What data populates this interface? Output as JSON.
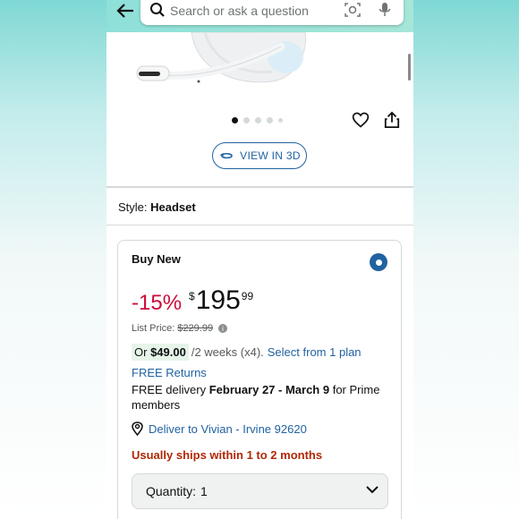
{
  "header": {
    "search_placeholder": "Search or ask a question",
    "icons": [
      "back-arrow-icon",
      "search-icon",
      "camera-lens-icon",
      "microphone-icon"
    ]
  },
  "gallery": {
    "dot_count": 5,
    "active_index": 0,
    "view_3d_label": "VIEW IN 3D"
  },
  "style": {
    "label": "Style:",
    "value": "Headset"
  },
  "buy_box": {
    "title": "Buy New",
    "discount": "-15%",
    "currency": "$",
    "price_whole": "195",
    "price_fraction": "99",
    "list_price_label": "List Price:",
    "list_price": "$229.99",
    "installment_or": "Or",
    "installment_amount": "$49.00",
    "installment_terms": "/2 weeks (x4).",
    "installment_link": "Select from 1 plan",
    "free_returns": "FREE Returns",
    "delivery_prefix": "FREE delivery",
    "delivery_dates": "February 27 - March 9",
    "delivery_suffix": "for Prime members",
    "deliver_to": "Deliver to Vivian - Irvine 92620",
    "ships_notice": "Usually ships within 1 to 2 months",
    "quantity_label": "Quantity:",
    "quantity_value": "1"
  },
  "colors": {
    "link": "#2162a1",
    "discount": "#cc0c39",
    "ships": "#b12704",
    "header_bg": "#8ee0d9"
  }
}
